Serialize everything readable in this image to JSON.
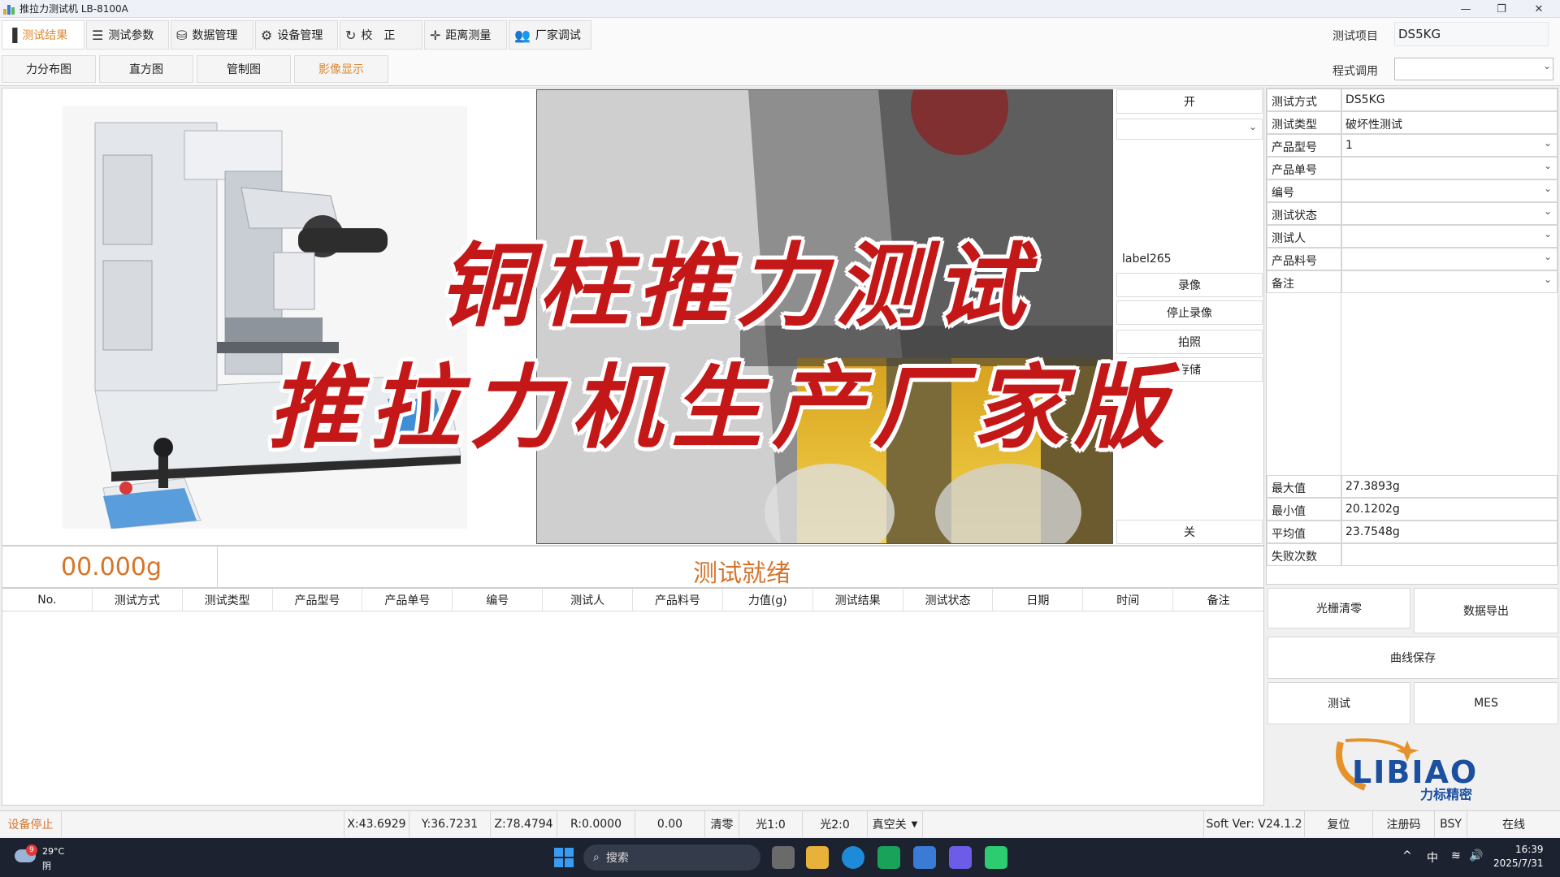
{
  "window": {
    "title": "推拉力测试机 LB-8100A",
    "minimize": "—",
    "restore": "❐",
    "close": "✕"
  },
  "toolbar": {
    "buttons": [
      {
        "label": "测试结果",
        "icon": "bar-chart-icon"
      },
      {
        "label": "测试参数",
        "icon": "sliders-icon"
      },
      {
        "label": "数据管理",
        "icon": "database-icon"
      },
      {
        "label": "设备管理",
        "icon": "gears-icon"
      },
      {
        "label": "校　正",
        "icon": "refresh-icon"
      },
      {
        "label": "距离测量",
        "icon": "crosshair-icon"
      },
      {
        "label": "厂家调试",
        "icon": "users-icon"
      }
    ],
    "project_label": "测试项目",
    "project_value": "DS5KG"
  },
  "subtabs": {
    "items": [
      "力分布图",
      "直方图",
      "管制图",
      "影像显示"
    ],
    "program_label": "程式调用"
  },
  "camera": {
    "open_button": "开",
    "label": "label265",
    "record_button": "录像",
    "stop_record_button": "停止录像",
    "photo_button": "拍照",
    "save_button": "存储",
    "close_button": "关"
  },
  "overlay": {
    "line1": "铜柱推力测试",
    "line2": "推拉力机生产厂家版"
  },
  "form": {
    "fields": [
      {
        "label": "测试方式",
        "value": "DS5KG"
      },
      {
        "label": "测试类型",
        "value": "破坏性测试"
      },
      {
        "label": "产品型号",
        "value": "1"
      },
      {
        "label": "产品单号",
        "value": ""
      },
      {
        "label": "编号",
        "value": ""
      },
      {
        "label": "测试状态",
        "value": ""
      },
      {
        "label": "测试人",
        "value": ""
      },
      {
        "label": "产品料号",
        "value": ""
      },
      {
        "label": "备注",
        "value": ""
      }
    ],
    "stats": [
      {
        "label": "最大值",
        "value": "27.3893g"
      },
      {
        "label": "最小值",
        "value": "20.1202g"
      },
      {
        "label": "平均值",
        "value": "23.7548g"
      },
      {
        "label": "失败次数",
        "value": ""
      }
    ]
  },
  "readout": {
    "force": "00.000g",
    "status": "测试就绪"
  },
  "table": {
    "columns": [
      "No.",
      "测试方式",
      "测试类型",
      "产品型号",
      "产品单号",
      "编号",
      "测试人",
      "产品料号",
      "力值(g)",
      "测试结果",
      "测试状态",
      "日期",
      "时间",
      "备注"
    ]
  },
  "actions": {
    "grating_zero": "光栅清零",
    "data_export": "数据导出",
    "curve_save": "曲线保存",
    "test": "测试",
    "mes": "MES"
  },
  "logo": {
    "text": "LIBIAO",
    "subtext": "力标精密"
  },
  "statusbar": {
    "device_state": "设备停止",
    "x": "X:43.6929",
    "y": "Y:36.7231",
    "z": "Z:78.4794",
    "r": "R:0.0000",
    "value": "0.00",
    "clear": "清零",
    "light1": "光1:0",
    "light2": "光2:0",
    "vacuum": "真空关",
    "version": "Soft Ver:  V24.1.2",
    "reset": "复位",
    "register": "注册码",
    "bsy": "BSY",
    "online": "在线"
  },
  "taskbar": {
    "weather_badge": "9",
    "temperature": "29°C",
    "condition": "阴",
    "search_placeholder": "搜索",
    "ime": "中",
    "time": "16:39",
    "date": "2025/7/31"
  }
}
